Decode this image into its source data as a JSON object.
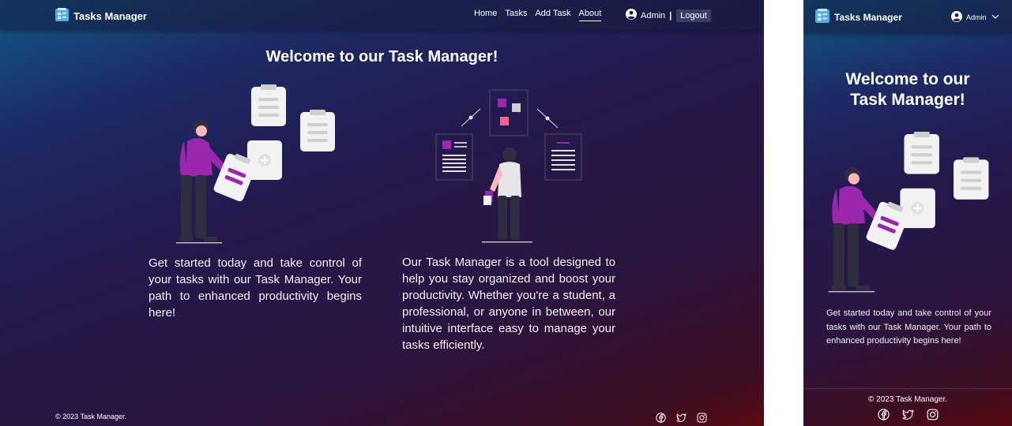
{
  "brand": {
    "name": "Tasks Manager"
  },
  "nav": {
    "links": [
      "Home",
      "Tasks",
      "Add Task",
      "About"
    ],
    "active": "About",
    "user": "Admin",
    "separator": "|",
    "logout": "Logout"
  },
  "main": {
    "title": "Welcome to our Task Manager!",
    "left_text": "Get started today and take control of your tasks with our Task Manager. Your path to enhanced productivity begins here!",
    "right_text": "Our Task Manager is a tool designed to help you stay organized and boost your productivity. Whether you're a student, a professional, or anyone in between, our intuitive interface easy to manage your tasks efficiently."
  },
  "footer": {
    "copyright": "© 2023 Task Manager.",
    "social": [
      "facebook-icon",
      "twitter-icon",
      "instagram-icon"
    ]
  },
  "mobile": {
    "title_line1": "Welcome to our",
    "title_line2": "Task Manager!"
  },
  "colors": {
    "accent": "#9b27af",
    "nav_bg": "#16193c",
    "logout_bg": "#3b3e63"
  }
}
